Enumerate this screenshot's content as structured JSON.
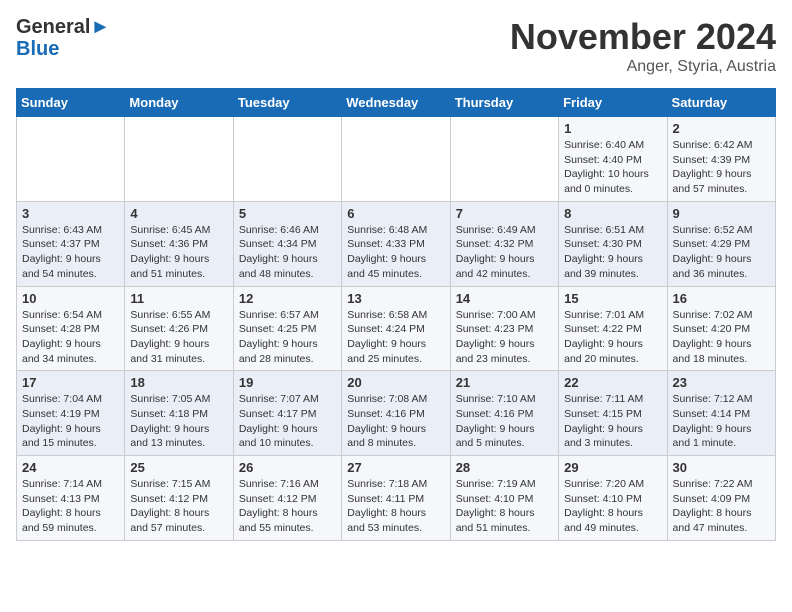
{
  "header": {
    "logo_line1": "General",
    "logo_line2": "Blue",
    "month_title": "November 2024",
    "location": "Anger, Styria, Austria"
  },
  "days_of_week": [
    "Sunday",
    "Monday",
    "Tuesday",
    "Wednesday",
    "Thursday",
    "Friday",
    "Saturday"
  ],
  "weeks": [
    [
      {
        "day": "",
        "info": ""
      },
      {
        "day": "",
        "info": ""
      },
      {
        "day": "",
        "info": ""
      },
      {
        "day": "",
        "info": ""
      },
      {
        "day": "",
        "info": ""
      },
      {
        "day": "1",
        "info": "Sunrise: 6:40 AM\nSunset: 4:40 PM\nDaylight: 10 hours\nand 0 minutes."
      },
      {
        "day": "2",
        "info": "Sunrise: 6:42 AM\nSunset: 4:39 PM\nDaylight: 9 hours\nand 57 minutes."
      }
    ],
    [
      {
        "day": "3",
        "info": "Sunrise: 6:43 AM\nSunset: 4:37 PM\nDaylight: 9 hours\nand 54 minutes."
      },
      {
        "day": "4",
        "info": "Sunrise: 6:45 AM\nSunset: 4:36 PM\nDaylight: 9 hours\nand 51 minutes."
      },
      {
        "day": "5",
        "info": "Sunrise: 6:46 AM\nSunset: 4:34 PM\nDaylight: 9 hours\nand 48 minutes."
      },
      {
        "day": "6",
        "info": "Sunrise: 6:48 AM\nSunset: 4:33 PM\nDaylight: 9 hours\nand 45 minutes."
      },
      {
        "day": "7",
        "info": "Sunrise: 6:49 AM\nSunset: 4:32 PM\nDaylight: 9 hours\nand 42 minutes."
      },
      {
        "day": "8",
        "info": "Sunrise: 6:51 AM\nSunset: 4:30 PM\nDaylight: 9 hours\nand 39 minutes."
      },
      {
        "day": "9",
        "info": "Sunrise: 6:52 AM\nSunset: 4:29 PM\nDaylight: 9 hours\nand 36 minutes."
      }
    ],
    [
      {
        "day": "10",
        "info": "Sunrise: 6:54 AM\nSunset: 4:28 PM\nDaylight: 9 hours\nand 34 minutes."
      },
      {
        "day": "11",
        "info": "Sunrise: 6:55 AM\nSunset: 4:26 PM\nDaylight: 9 hours\nand 31 minutes."
      },
      {
        "day": "12",
        "info": "Sunrise: 6:57 AM\nSunset: 4:25 PM\nDaylight: 9 hours\nand 28 minutes."
      },
      {
        "day": "13",
        "info": "Sunrise: 6:58 AM\nSunset: 4:24 PM\nDaylight: 9 hours\nand 25 minutes."
      },
      {
        "day": "14",
        "info": "Sunrise: 7:00 AM\nSunset: 4:23 PM\nDaylight: 9 hours\nand 23 minutes."
      },
      {
        "day": "15",
        "info": "Sunrise: 7:01 AM\nSunset: 4:22 PM\nDaylight: 9 hours\nand 20 minutes."
      },
      {
        "day": "16",
        "info": "Sunrise: 7:02 AM\nSunset: 4:20 PM\nDaylight: 9 hours\nand 18 minutes."
      }
    ],
    [
      {
        "day": "17",
        "info": "Sunrise: 7:04 AM\nSunset: 4:19 PM\nDaylight: 9 hours\nand 15 minutes."
      },
      {
        "day": "18",
        "info": "Sunrise: 7:05 AM\nSunset: 4:18 PM\nDaylight: 9 hours\nand 13 minutes."
      },
      {
        "day": "19",
        "info": "Sunrise: 7:07 AM\nSunset: 4:17 PM\nDaylight: 9 hours\nand 10 minutes."
      },
      {
        "day": "20",
        "info": "Sunrise: 7:08 AM\nSunset: 4:16 PM\nDaylight: 9 hours\nand 8 minutes."
      },
      {
        "day": "21",
        "info": "Sunrise: 7:10 AM\nSunset: 4:16 PM\nDaylight: 9 hours\nand 5 minutes."
      },
      {
        "day": "22",
        "info": "Sunrise: 7:11 AM\nSunset: 4:15 PM\nDaylight: 9 hours\nand 3 minutes."
      },
      {
        "day": "23",
        "info": "Sunrise: 7:12 AM\nSunset: 4:14 PM\nDaylight: 9 hours\nand 1 minute."
      }
    ],
    [
      {
        "day": "24",
        "info": "Sunrise: 7:14 AM\nSunset: 4:13 PM\nDaylight: 8 hours\nand 59 minutes."
      },
      {
        "day": "25",
        "info": "Sunrise: 7:15 AM\nSunset: 4:12 PM\nDaylight: 8 hours\nand 57 minutes."
      },
      {
        "day": "26",
        "info": "Sunrise: 7:16 AM\nSunset: 4:12 PM\nDaylight: 8 hours\nand 55 minutes."
      },
      {
        "day": "27",
        "info": "Sunrise: 7:18 AM\nSunset: 4:11 PM\nDaylight: 8 hours\nand 53 minutes."
      },
      {
        "day": "28",
        "info": "Sunrise: 7:19 AM\nSunset: 4:10 PM\nDaylight: 8 hours\nand 51 minutes."
      },
      {
        "day": "29",
        "info": "Sunrise: 7:20 AM\nSunset: 4:10 PM\nDaylight: 8 hours\nand 49 minutes."
      },
      {
        "day": "30",
        "info": "Sunrise: 7:22 AM\nSunset: 4:09 PM\nDaylight: 8 hours\nand 47 minutes."
      }
    ]
  ]
}
